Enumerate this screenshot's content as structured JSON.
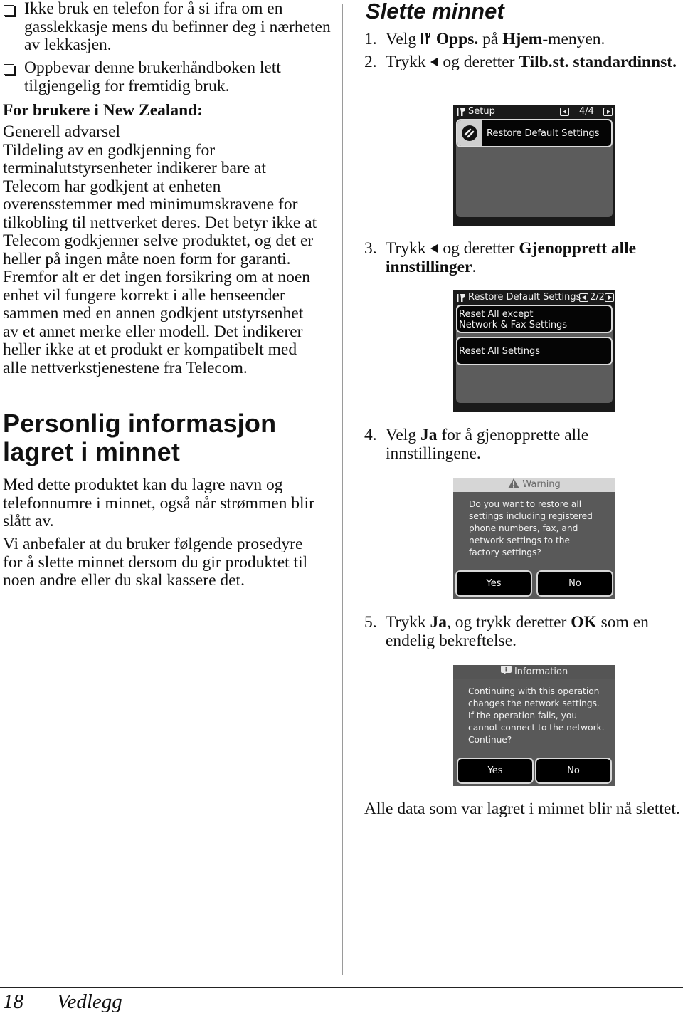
{
  "left_column": {
    "bullets": [
      "Ikke bruk en telefon for å si ifra om en gasslekkasje mens du befinner deg i nærheten av lekkasjen.",
      "Oppbevar denne brukerhåndboken lett tilgjengelig for fremtidig bruk."
    ],
    "nz_heading": "For brukere i New Zealand:",
    "nz_subheading": "Generell advarsel",
    "nz_body": "Tildeling av en godkjenning for terminalutstyrsenheter indikerer bare at Telecom har godkjent at enheten overensstemmer med minimumskravene for tilkobling til nettverket deres. Det betyr ikke at Telecom godkjenner selve produktet, og det er heller på ingen måte noen form for garanti. Fremfor alt er det ingen forsikring om at noen enhet vil fungere korrekt i alle henseender sammen med en annen godkjent utstyrsenhet av et annet merke eller modell. Det indikerer heller ikke at et produkt er kompatibelt med alle nettverkstjenestene fra Telecom.",
    "section_heading_line1": "Personlig informasjon",
    "section_heading_line2": "lagret i minnet",
    "paragraph1": "Med dette produktet kan du lagre navn og telefonnumre i minnet, også når strømmen blir slått av.",
    "paragraph2": "Vi anbefaler at du bruker følgende prosedyre for å slette minnet dersom du gir produktet til noen andre eller du skal kassere det."
  },
  "right_column": {
    "heading": "Slette minnet",
    "steps": [
      {
        "num": "1.",
        "pre": "Velg ",
        "icon": "wrench-setup-icon",
        "b1": "Opps.",
        "mid": " på ",
        "b2": "Hjem",
        "post": "-menyen."
      },
      {
        "num": "2.",
        "pre": "Trykk ",
        "icon": "left-arrow-icon",
        "mid": " og deretter ",
        "b1": "Tilb.st. standardinnst."
      },
      {
        "num": "3.",
        "pre": "Trykk ",
        "icon": "left-arrow-icon",
        "mid": " og deretter ",
        "b1": "Gjenopprett alle innstillinger",
        "post": "."
      },
      {
        "num": "4.",
        "pre": "Velg ",
        "b1": "Ja",
        "post": " for å gjenopprette alle innstillingene."
      },
      {
        "num": "5.",
        "pre": "Trykk ",
        "b1": "Ja",
        "mid": ", og trykk deretter ",
        "b2": "OK",
        "post": " som en endelig bekreftelse."
      }
    ],
    "screen1": {
      "title": "Setup",
      "page": "4/4",
      "item": "Restore Default Settings"
    },
    "screen2": {
      "title": "Restore Default Settings",
      "page": "2/2",
      "item1_line1": "Reset All except",
      "item1_line2": "Network & Fax Settings",
      "item2": "Reset All Settings"
    },
    "screen3": {
      "title": "Warning",
      "message": [
        "Do you want to restore all",
        "settings including registered",
        "phone numbers, fax, and",
        "network settings to the",
        "factory settings?"
      ],
      "yes": "Yes",
      "no": "No"
    },
    "screen4": {
      "title": "Information",
      "message": [
        "Continuing with this operation",
        "changes the network settings.",
        "If the operation fails, you",
        "cannot connect to the network.",
        "Continue?"
      ],
      "yes": "Yes",
      "no": "No"
    },
    "closing": "Alle data som var lagret i minnet blir nå slettet."
  },
  "footer": {
    "page_number": "18",
    "section": "Vedlegg"
  }
}
